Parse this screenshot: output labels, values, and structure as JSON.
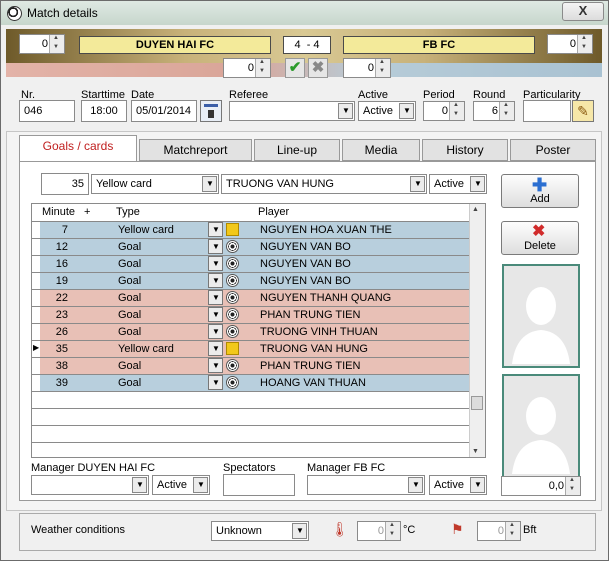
{
  "window": {
    "title": "Match details",
    "close_label": "X"
  },
  "match": {
    "home_team": "DUYEN HAI FC",
    "away_team": "FB FC",
    "home_score": "4",
    "score_sep": "-",
    "away_score": "4",
    "home_spin": "0",
    "away_spin": "0",
    "pen_home": "0",
    "pen_away": "0"
  },
  "info": {
    "nr_label": "Nr.",
    "nr_value": "046",
    "starttime_label": "Starttime",
    "starttime_value": "18:00",
    "date_label": "Date",
    "date_value": "05/01/2014",
    "referee_label": "Referee",
    "referee_value": "",
    "active_label": "Active",
    "active_value": "Active",
    "period_label": "Period",
    "period_value": "0",
    "round_label": "Round",
    "round_value": "6",
    "particularity_label": "Particularity",
    "particularity_value": ""
  },
  "tabs": [
    "Goals / cards",
    "Matchreport",
    "Line-up",
    "Media",
    "History",
    "Poster"
  ],
  "editor": {
    "minute": "35",
    "type": "Yellow card",
    "player": "TRUONG VAN HUNG",
    "status": "Active"
  },
  "grid": {
    "headers": {
      "minute": "Minute",
      "plus": "+",
      "type": "Type",
      "player": "Player"
    },
    "rows": [
      {
        "minute": "7",
        "type": "Yellow card",
        "player": "NGUYEN HOA XUAN THE",
        "side": "blue",
        "icon": "yellow"
      },
      {
        "minute": "12",
        "type": "Goal",
        "player": "NGUYEN VAN BO",
        "side": "blue",
        "icon": "ball"
      },
      {
        "minute": "16",
        "type": "Goal",
        "player": "NGUYEN VAN BO",
        "side": "blue",
        "icon": "ball"
      },
      {
        "minute": "19",
        "type": "Goal",
        "player": "NGUYEN VAN BO",
        "side": "blue",
        "icon": "ball"
      },
      {
        "minute": "22",
        "type": "Goal",
        "player": "NGUYEN THANH QUANG",
        "side": "pink",
        "icon": "ball"
      },
      {
        "minute": "23",
        "type": "Goal",
        "player": "PHAN TRUNG TIEN",
        "side": "pink",
        "icon": "ball"
      },
      {
        "minute": "26",
        "type": "Goal",
        "player": "TRUONG VINH THUAN",
        "side": "pink",
        "icon": "ball"
      },
      {
        "minute": "35",
        "type": "Yellow card",
        "player": "TRUONG VAN HUNG",
        "side": "pink",
        "icon": "yellow"
      },
      {
        "minute": "38",
        "type": "Goal",
        "player": "PHAN TRUNG TIEN",
        "side": "pink",
        "icon": "ball"
      },
      {
        "minute": "39",
        "type": "Goal",
        "player": "HOANG VAN THUAN",
        "side": "blue",
        "icon": "ball"
      }
    ]
  },
  "buttons": {
    "add": "Add",
    "delete": "Delete"
  },
  "bottom": {
    "manager_home_label": "Manager DUYEN HAI FC",
    "manager_home_status": "Active",
    "spectators_label": "Spectators",
    "manager_away_label": "Manager FB FC",
    "manager_away_status": "Active",
    "rating_value": "0,0"
  },
  "weather": {
    "label": "Weather conditions",
    "condition": "Unknown",
    "temp_value": "0",
    "temp_unit": "°C",
    "wind_value": "0",
    "wind_unit": "Bft"
  }
}
